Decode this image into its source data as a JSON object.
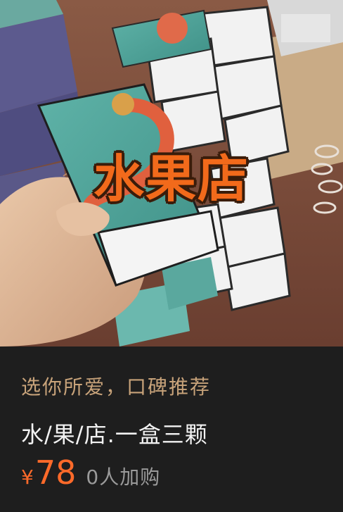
{
  "product": {
    "image_overlay_text": "水果店",
    "tagline": "选你所爱，口碑推荐",
    "title": "水/果/店.一盒三颗",
    "currency_symbol": "¥",
    "price": "78",
    "buyers_text": "0人加购"
  },
  "colors": {
    "background": "#1e1e1e",
    "tagline": "#c8a37a",
    "price": "#ff6a2a",
    "overlay_text": "#f26a1b",
    "muted": "#9a9a9a"
  }
}
